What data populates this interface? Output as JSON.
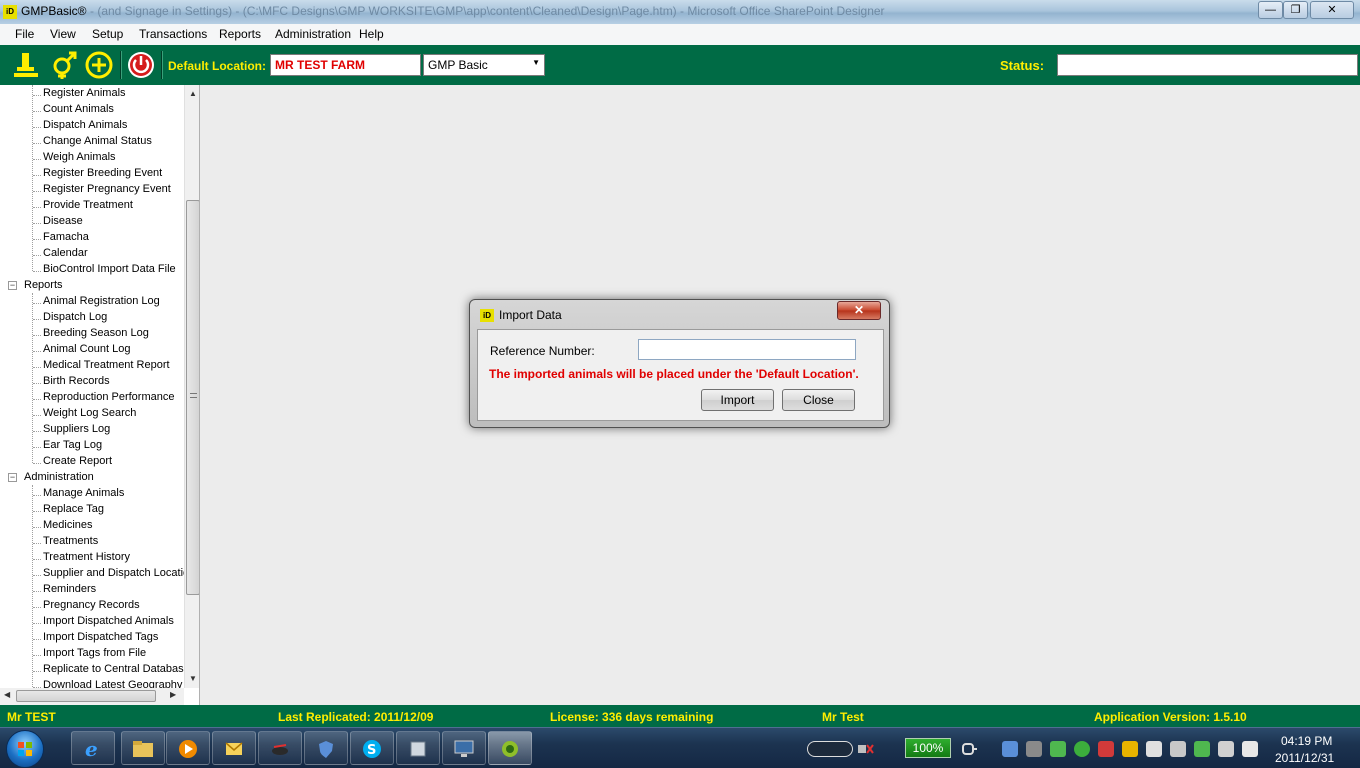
{
  "window": {
    "title": "GMPBasic®",
    "faded_title": "- (and Signage in Settings) - (C:\\MFC Designs\\GMP WORKSITE\\GMP\\app\\content\\Cleaned\\Design\\Page.htm) - Microsoft Office SharePoint Designer",
    "app_icon_text": "iD",
    "minimize_glyph": "—",
    "maximize_glyph": "❐",
    "close_glyph": "✕"
  },
  "menu": {
    "items": [
      "File",
      "View",
      "Setup",
      "Transactions",
      "Reports",
      "Administration",
      "Help"
    ]
  },
  "toolbar": {
    "default_location_label": "Default Location:",
    "default_location_value": "MR TEST FARM",
    "profile_select_value": "GMP Basic",
    "caret": "▼",
    "status_label": "Status:",
    "status_value": ""
  },
  "tree": {
    "transactions_items": [
      "Register Animals",
      "Count Animals",
      "Dispatch Animals",
      "Change Animal Status",
      "Weigh Animals",
      "Register Breeding Event",
      "Register Pregnancy Event",
      "Provide Treatment",
      "Disease",
      "Famacha",
      "Calendar",
      "BioControl Import Data File"
    ],
    "reports_label": "Reports",
    "reports_items": [
      "Animal Registration Log",
      "Dispatch Log",
      "Breeding Season Log",
      "Animal Count Log",
      "Medical Treatment Report",
      "Birth Records",
      "Reproduction Performance",
      "Weight Log Search",
      "Suppliers Log",
      "Ear Tag Log",
      "Create Report"
    ],
    "admin_label": "Administration",
    "admin_items": [
      "Manage Animals",
      "Replace Tag",
      "Medicines",
      "Treatments",
      "Treatment History",
      "Supplier and Dispatch Locatic",
      "Reminders",
      "Pregnancy Records",
      "Import Dispatched Animals",
      "Import Dispatched Tags",
      "Import Tags from File",
      "Replicate to Central Database",
      "Download Latest Geography"
    ],
    "collapse_glyph": "−",
    "scroll_up": "▲",
    "scroll_down": "▼",
    "scroll_left": "◀",
    "scroll_right": "▶"
  },
  "dialog": {
    "title": "Import Data",
    "icon_text": "iD",
    "close_glyph": "✕",
    "reference_label": "Reference Number:",
    "reference_value": "",
    "warning": "The imported animals will be placed under the 'Default Location'.",
    "import_button": "Import",
    "close_button": "Close"
  },
  "statusbar": {
    "user": "Mr TEST",
    "last_replicated": "Last Replicated: 2011/12/09",
    "license": "License: 336 days remaining",
    "user_name": "Mr Test",
    "version": "Application Version: 1.5.10"
  },
  "taskbar": {
    "battery": "100%",
    "time": "04:19 PM",
    "date": "2011/12/31",
    "apps": [
      "ie-icon",
      "explorer-icon",
      "media-player-icon",
      "mail-icon",
      "photo-icon",
      "shield-icon",
      "skype-icon",
      "app-icon",
      "remote-desktop-icon",
      "gmp-icon"
    ]
  },
  "colors": {
    "brand_green": "#006b45",
    "label_yellow": "#ffee00",
    "alert_red": "#e00000"
  }
}
